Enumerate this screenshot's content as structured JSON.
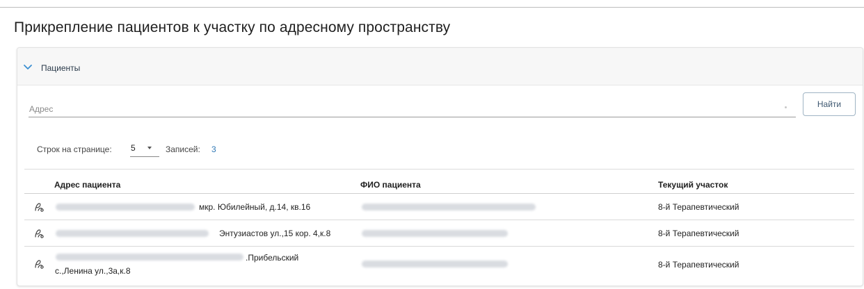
{
  "page": {
    "title": "Прикрепление пациентов к участку по адресному пространству"
  },
  "panel": {
    "header_label": "Пациенты",
    "address_placeholder": "Адрес",
    "find_button": "Найти"
  },
  "pagination": {
    "rows_label": "Строк на странице:",
    "rows_value": "5",
    "records_label": "Записей:",
    "records_count": "3"
  },
  "table": {
    "columns": [
      "Адрес пациента",
      "ФИО пациента",
      "Текущий участок"
    ],
    "rows": [
      {
        "address_visible": "мкр. Юбилейный, д.14, кв.16",
        "address_second_line": "",
        "area": "8-й Терапевтический"
      },
      {
        "address_visible": "Энтузиастов ул.,15 кор. 4,к.8",
        "address_second_line": "",
        "area": "8-й Терапевтический"
      },
      {
        "address_visible": ".Прибельский",
        "address_second_line": "с.,Ленина ул.,3а,к.8",
        "area": "8-й Терапевтический"
      }
    ]
  },
  "icons": {
    "row_action": "person-link-icon",
    "panel_toggle": "chevron-down-icon"
  },
  "colors": {
    "accent": "#2f78b5",
    "button_border": "#9fb4c4",
    "header_bg": "#f7f7f7"
  }
}
